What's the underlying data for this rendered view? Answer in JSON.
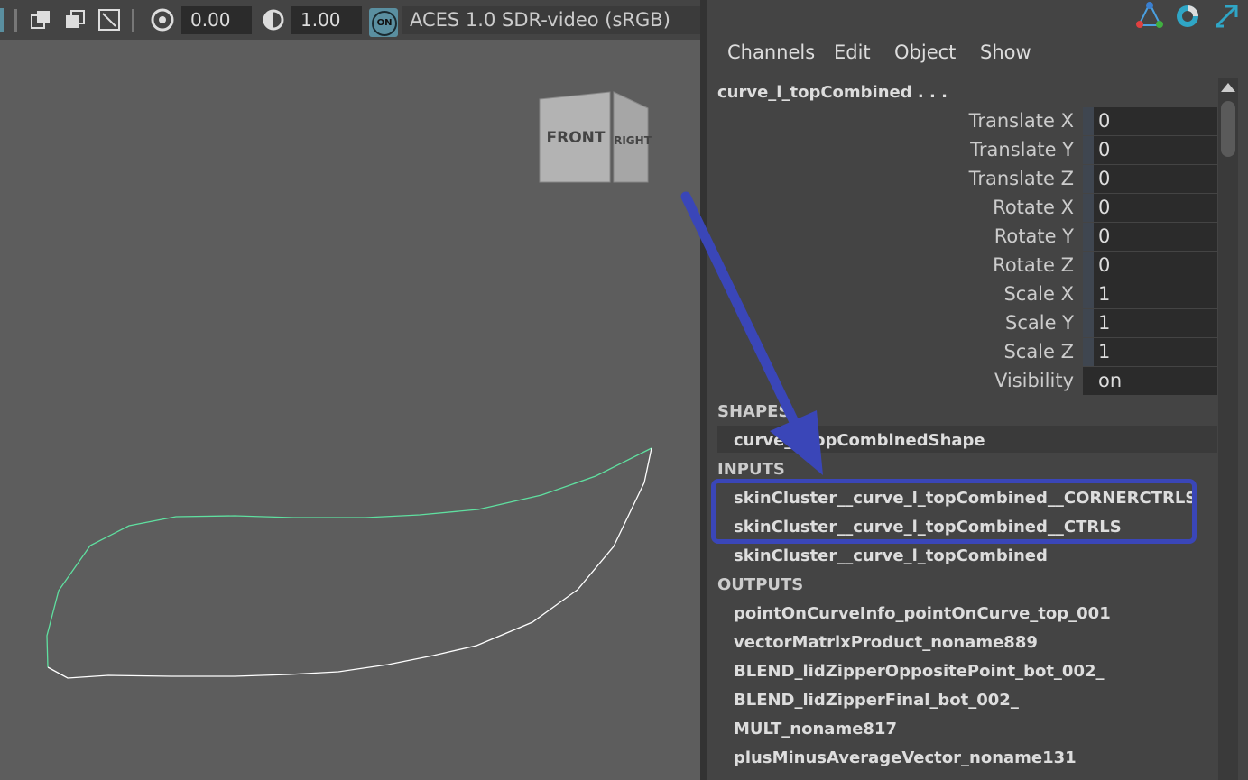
{
  "viewport": {
    "exposure_value": "0.00",
    "gamma_value": "1.00",
    "on_label": "ON",
    "color_space": "ACES 1.0 SDR-video (sRGB)",
    "viewcube_front": "FRONT",
    "viewcube_right": "RIGHT"
  },
  "channel_box": {
    "menu": [
      "Channels",
      "Edit",
      "Object",
      "Show"
    ],
    "object_name": "curve_l_topCombined . . .",
    "attributes": [
      {
        "label": "Translate X",
        "value": "0"
      },
      {
        "label": "Translate Y",
        "value": "0"
      },
      {
        "label": "Translate Z",
        "value": "0"
      },
      {
        "label": "Rotate X",
        "value": "0"
      },
      {
        "label": "Rotate Y",
        "value": "0"
      },
      {
        "label": "Rotate Z",
        "value": "0"
      },
      {
        "label": "Scale X",
        "value": "1"
      },
      {
        "label": "Scale Y",
        "value": "1"
      },
      {
        "label": "Scale Z",
        "value": "1"
      },
      {
        "label": "Visibility",
        "value": "on"
      }
    ],
    "shapes_header": "SHAPES",
    "shapes": [
      "curve_l_topCombinedShape"
    ],
    "inputs_header": "INPUTS",
    "inputs": [
      "skinCluster__curve_l_topCombined__CORNERCTRLS",
      "skinCluster__curve_l_topCombined__CTRLS",
      "skinCluster__curve_l_topCombined"
    ],
    "outputs_header": "OUTPUTS",
    "outputs": [
      "pointOnCurveInfo_pointOnCurve_top_001",
      "vectorMatrixProduct_noname889",
      "BLEND_lidZipperOppositePoint_bot_002_",
      "BLEND_lidZipperFinal_bot_002_",
      "MULT_noname817",
      "plusMinusAverageVector_noname131"
    ]
  },
  "colors": {
    "highlight": "#3a46b8",
    "curve_selected": "#5fe0a0",
    "curve_unselected": "#ffffff"
  }
}
